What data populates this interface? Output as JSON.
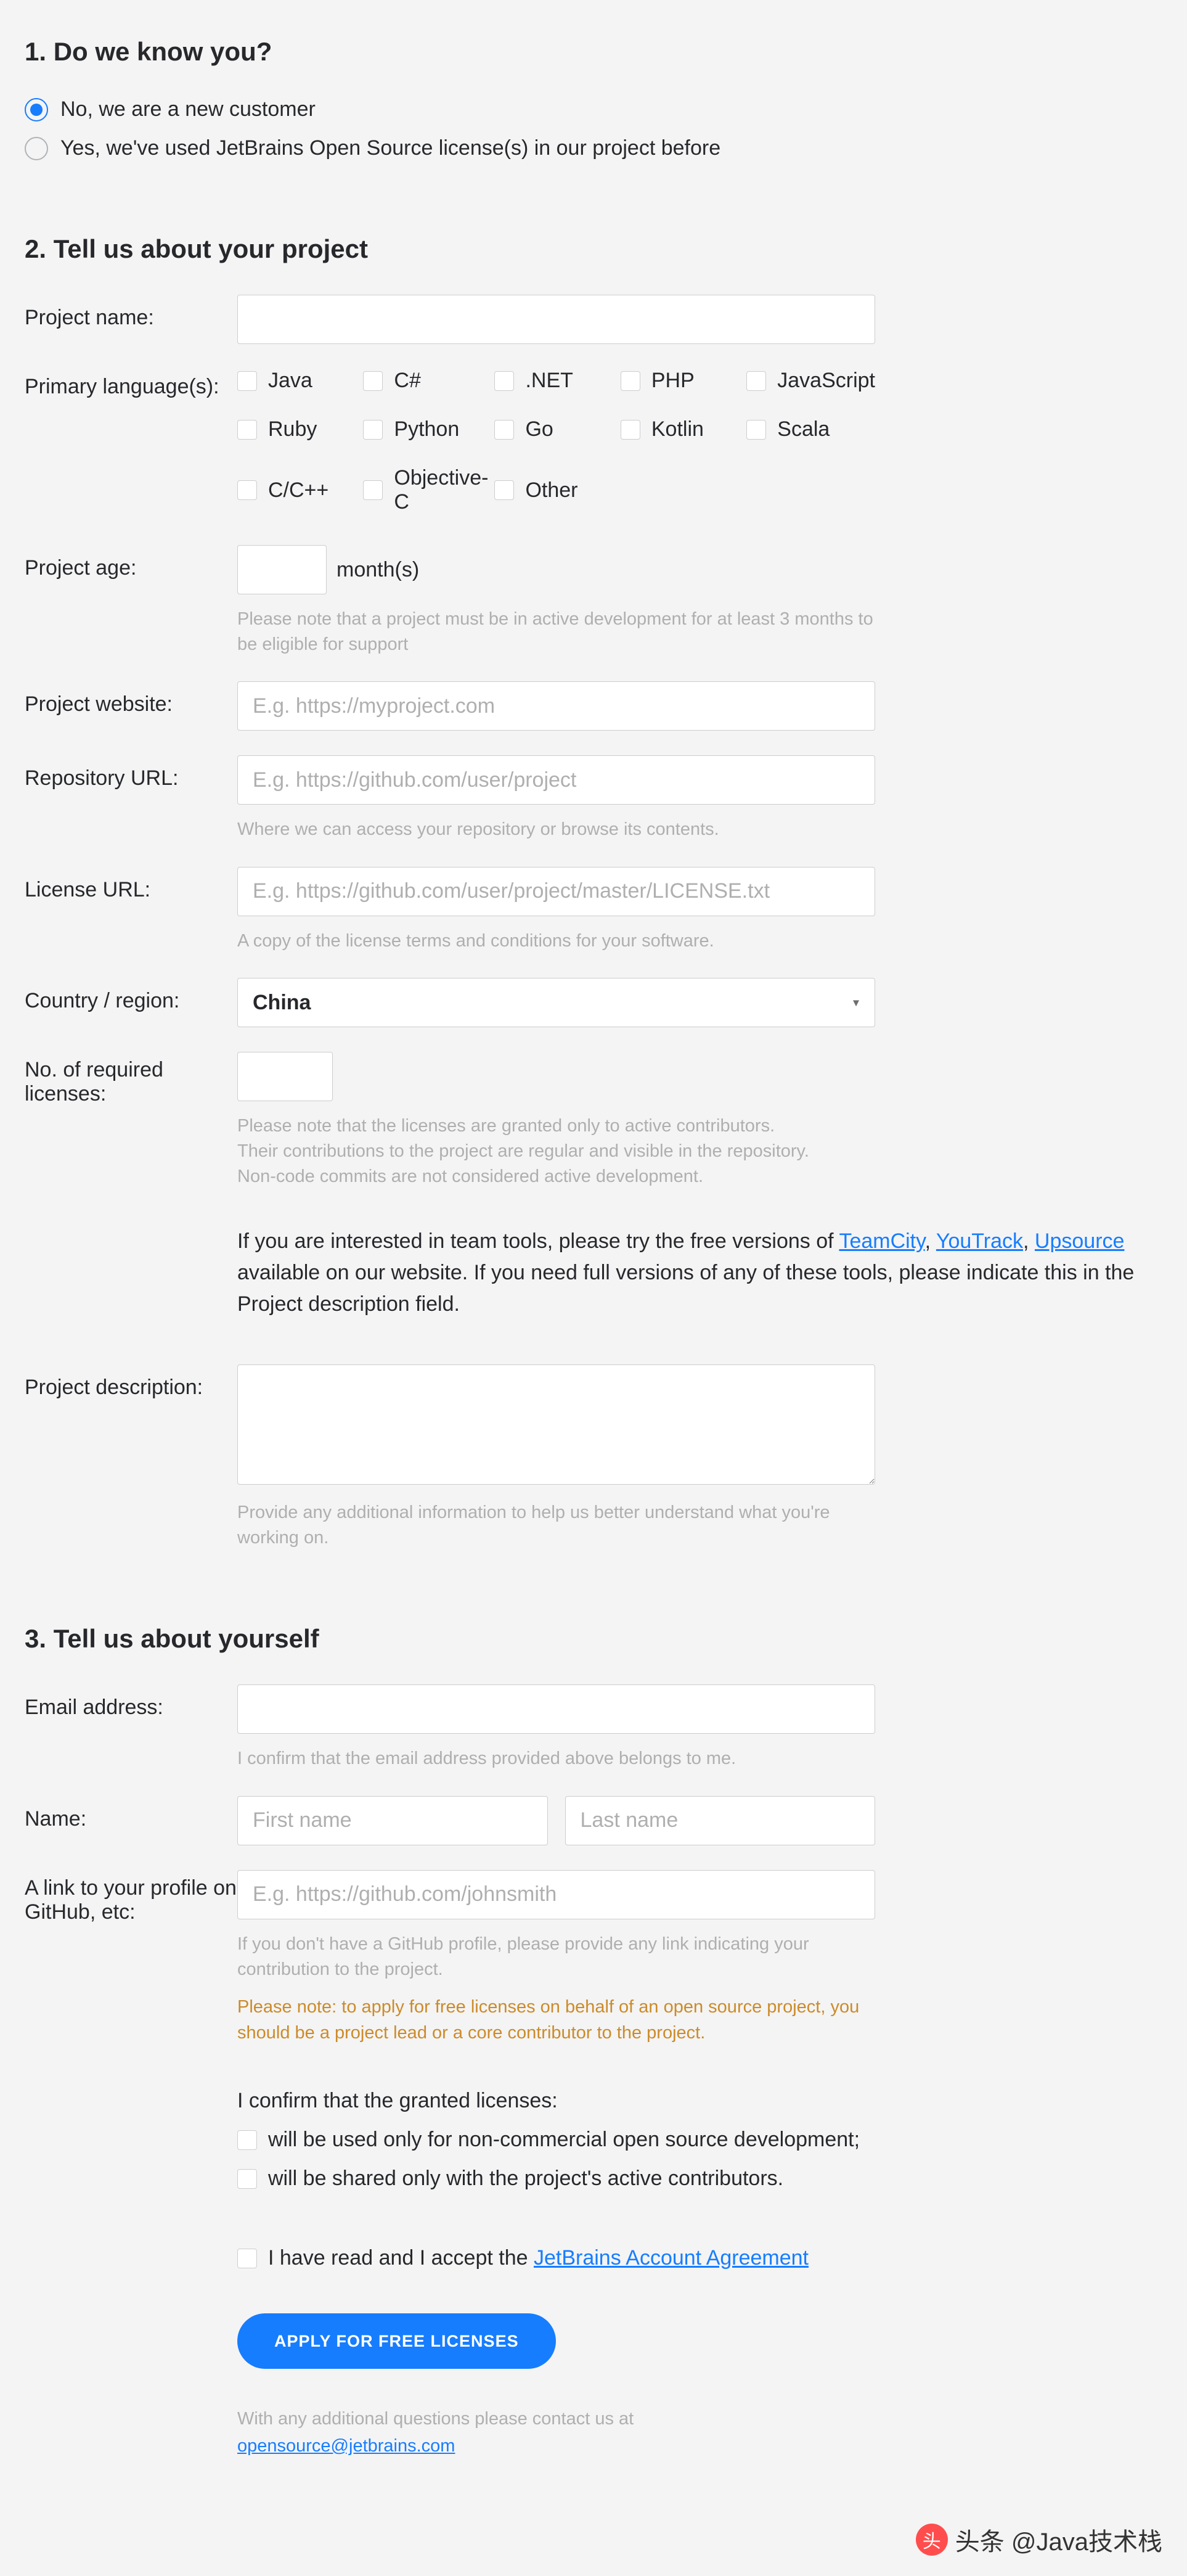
{
  "section1": {
    "heading": "1.  Do we know you?",
    "options": {
      "new_customer": "No, we are a new customer",
      "existing": "Yes, we've used JetBrains Open Source license(s) in our project before"
    }
  },
  "section2": {
    "heading": "2. Tell us about your project",
    "project_name_label": "Project name:",
    "languages_label": "Primary language(s):",
    "languages": [
      "Java",
      "C#",
      ".NET",
      "PHP",
      "JavaScript",
      "Ruby",
      "Python",
      "Go",
      "Kotlin",
      "Scala",
      "C/C++",
      "Objective-C",
      "Other"
    ],
    "project_age_label": "Project age:",
    "months_suffix": "month(s)",
    "age_hint": "Please note that a project must be in active development for at least 3 months to be eligible for support",
    "website_label": "Project website:",
    "website_placeholder": "E.g. https://myproject.com",
    "repo_label": "Repository URL:",
    "repo_placeholder": "E.g. https://github.com/user/project",
    "repo_hint": "Where we can access your repository or browse its contents.",
    "license_label": "License URL:",
    "license_placeholder": "E.g. https://github.com/user/project/master/LICENSE.txt",
    "license_hint": "A copy of the license terms and conditions for your software.",
    "country_label": "Country / region:",
    "country_value": "China",
    "licenses_label": "No. of required licenses:",
    "licenses_hint": "Please note that the licenses are granted only to active contributors.\nTheir contributions to the project are regular and visible in the repository.\nNon-code commits are not considered active development.",
    "team_tools_prefix": "If you are interested in team tools, please try the free versions of ",
    "team_tools_link1": "TeamCity",
    "team_tools_link2": "YouTrack",
    "team_tools_link3": "Upsource",
    "team_tools_suffix": " available on our website. If you need full versions of any of these tools, please indicate this in the Project description field.",
    "description_label": "Project description:",
    "description_hint": "Provide any additional information to help us better understand what you're working on."
  },
  "section3": {
    "heading": "3. Tell us about yourself",
    "email_label": "Email address:",
    "email_hint": "I confirm that the email address provided above belongs to me.",
    "name_label": "Name:",
    "first_name_placeholder": "First name",
    "last_name_placeholder": "Last name",
    "profile_label": "A link to your profile on GitHub, etc:",
    "profile_placeholder": "E.g. https://github.com/johnsmith",
    "profile_hint": "If you don't have a GitHub profile, please provide any link indicating your contribution to the project.",
    "profile_warn": "Please note: to apply for free licenses on behalf of an open source project, you should be a project lead or a core contributor to the project.",
    "confirm_heading": "I confirm that the granted licenses:",
    "confirm_opt1": "will be used only for non-commercial open source development;",
    "confirm_opt2": "will be shared only with the project's active contributors.",
    "agreement_prefix": "I have read and I accept the ",
    "agreement_link": "JetBrains Account Agreement",
    "apply_button": "APPLY FOR FREE LICENSES",
    "contact_text": "With any additional questions please contact us at",
    "contact_email": "opensource@jetbrains.com"
  },
  "watermark": "头条 @Java技术栈"
}
